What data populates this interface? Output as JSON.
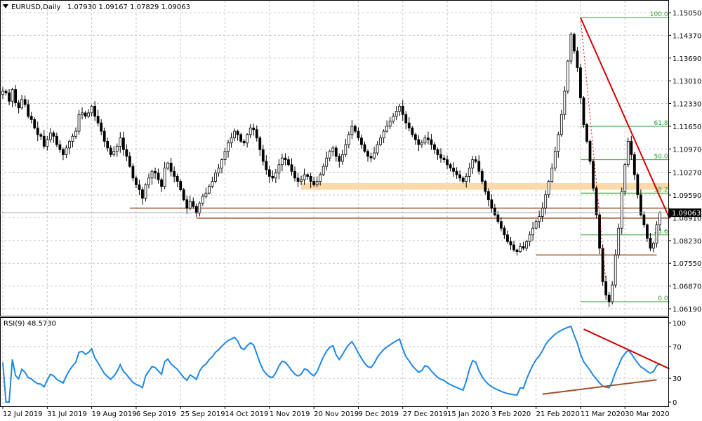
{
  "header": {
    "symbol_title": "EURUSD,Daily",
    "ohlc": "1.07930 1.09167 1.07829 1.09063",
    "current_price_label": "1.09063"
  },
  "rsi_panel": {
    "title": "RSI(9) 48.5730"
  },
  "colors": {
    "grid": "#c8c8c8",
    "candle": "#000000",
    "fib": "#2e9b2e",
    "trend_red": "#d40000",
    "support": "#a0522d",
    "zone": "#fcd9a8",
    "rsi_line": "#1e88e5",
    "rsi_trend_up": "#a0522d"
  },
  "chart_data": [
    {
      "type": "candlestick",
      "title": "EURUSD,Daily",
      "ylim": [
        1.0619,
        1.1505
      ],
      "y_ticks": [
        "1.15050",
        "1.14370",
        "1.13690",
        "1.13010",
        "1.12330",
        "1.11650",
        "1.10970",
        "1.10270",
        "1.09590",
        "1.08910",
        "1.08230",
        "1.07550",
        "1.06870",
        "1.06190"
      ],
      "x_ticks": [
        "12 Jul 2019",
        "31 Jul 2019",
        "19 Aug 2019",
        "6 Sep 2019",
        "25 Sep 2019",
        "14 Oct 2019",
        "1 Nov 2019",
        "20 Nov 2019",
        "9 Dec 2019",
        "27 Dec 2019",
        "15 Jan 2020",
        "3 Feb 2020",
        "21 Feb 2020",
        "11 Mar 2020",
        "30 Mar 2020"
      ],
      "x_tick_index": [
        0,
        14,
        28,
        42,
        56,
        70,
        84,
        98,
        112,
        126,
        140,
        154,
        168,
        182,
        196
      ],
      "last_close": 1.09063,
      "closes": [
        1.127,
        1.1265,
        1.124,
        1.1275,
        1.1235,
        1.122,
        1.1245,
        1.123,
        1.1195,
        1.1185,
        1.116,
        1.114,
        1.1135,
        1.1105,
        1.1125,
        1.1145,
        1.1135,
        1.111,
        1.1095,
        1.108,
        1.11,
        1.112,
        1.1135,
        1.115,
        1.12,
        1.1205,
        1.1195,
        1.1205,
        1.1225,
        1.1195,
        1.1175,
        1.115,
        1.112,
        1.11,
        1.108,
        1.109,
        1.1105,
        1.113,
        1.1095,
        1.1075,
        1.1045,
        1.101,
        1.099,
        1.0975,
        1.095,
        1.099,
        1.101,
        1.103,
        1.1025,
        1.1005,
        1.0985,
        1.104,
        1.1055,
        1.103,
        1.1015,
        1.1,
        1.0975,
        1.0945,
        1.092,
        1.094,
        1.0925,
        1.0905,
        1.0935,
        1.0955,
        1.0965,
        1.0985,
        1.1,
        1.1025,
        1.104,
        1.1065,
        1.109,
        1.1115,
        1.113,
        1.115,
        1.114,
        1.112,
        1.1115,
        1.114,
        1.116,
        1.1155,
        1.113,
        1.1095,
        1.106,
        1.1035,
        1.1015,
        1.101,
        1.1025,
        1.105,
        1.107,
        1.1065,
        1.105,
        1.103,
        1.101,
        1.1,
        1.1005,
        1.102,
        1.1015,
        1.1,
        1.099,
        1.1,
        1.102,
        1.1045,
        1.107,
        1.109,
        1.11,
        1.1075,
        1.106,
        1.108,
        1.111,
        1.114,
        1.1165,
        1.115,
        1.113,
        1.111,
        1.109,
        1.1075,
        1.107,
        1.1085,
        1.111,
        1.113,
        1.115,
        1.1165,
        1.118,
        1.1195,
        1.121,
        1.1225,
        1.12,
        1.1175,
        1.116,
        1.114,
        1.1125,
        1.111,
        1.1115,
        1.113,
        1.1125,
        1.111,
        1.1095,
        1.108,
        1.107,
        1.1065,
        1.105,
        1.104,
        1.103,
        1.102,
        1.101,
        1.1,
        1.1015,
        1.104,
        1.1065,
        1.106,
        1.103,
        1.1,
        1.097,
        1.0945,
        1.092,
        1.09,
        1.088,
        1.086,
        1.084,
        1.082,
        1.081,
        1.0795,
        1.079,
        1.0805,
        1.08,
        1.082,
        1.084,
        1.086,
        1.088,
        1.0895,
        1.092,
        1.096,
        1.1,
        1.104,
        1.109,
        1.114,
        1.12,
        1.127,
        1.136,
        1.144,
        1.139,
        1.134,
        1.125,
        1.117,
        1.112,
        1.106,
        1.098,
        1.09,
        1.08,
        1.07,
        1.066,
        1.064,
        1.069,
        1.078,
        1.086,
        1.097,
        1.105,
        1.112,
        1.108,
        1.102,
        1.096,
        1.09,
        1.087,
        1.083,
        1.08,
        1.0815,
        1.087,
        1.09063
      ],
      "trendlines": [
        {
          "from": [
            182,
            1.149
          ],
          "to": [
            210,
            1.089
          ],
          "color": "trend_red",
          "style": "solid"
        },
        {
          "from": [
            182,
            1.149
          ],
          "to": [
            190,
            1.07
          ],
          "color": "trend_red",
          "style": "dashed"
        }
      ],
      "horizontal_lines": [
        {
          "y": 1.092,
          "from_index": 40,
          "to_index": 210,
          "color": "support"
        },
        {
          "y": 1.089,
          "from_index": 61,
          "to_index": 210,
          "color": "support"
        },
        {
          "y": 1.078,
          "from_index": 168,
          "to_index": 206,
          "color": "support"
        }
      ],
      "zones": [
        {
          "y_low": 1.0975,
          "y_high": 1.0995,
          "from_index": 94,
          "to_index": 210,
          "color": "zone"
        }
      ],
      "fibonacci": {
        "from_index": 182,
        "to_index": 210,
        "levels": [
          {
            "label": "100.0",
            "value": 1.149
          },
          {
            "label": "61.8",
            "value": 1.1165
          },
          {
            "label": "50.0",
            "value": 1.1065
          },
          {
            "label": "38.2",
            "value": 1.0965
          },
          {
            "label": "23.6",
            "value": 1.084
          },
          {
            "label": "0.0",
            "value": 1.064
          }
        ]
      }
    },
    {
      "type": "line",
      "title": "RSI(9) 48.5730",
      "ylim": [
        0,
        100
      ],
      "y_ticks": [
        100,
        70,
        30,
        0
      ],
      "last_value": 48.573,
      "trendlines": [
        {
          "from": [
            183,
            92
          ],
          "to": [
            210,
            42
          ],
          "color": "trend_red"
        },
        {
          "from": [
            170,
            10
          ],
          "to": [
            206,
            28
          ],
          "color": "rsi_trend_up"
        }
      ]
    }
  ]
}
